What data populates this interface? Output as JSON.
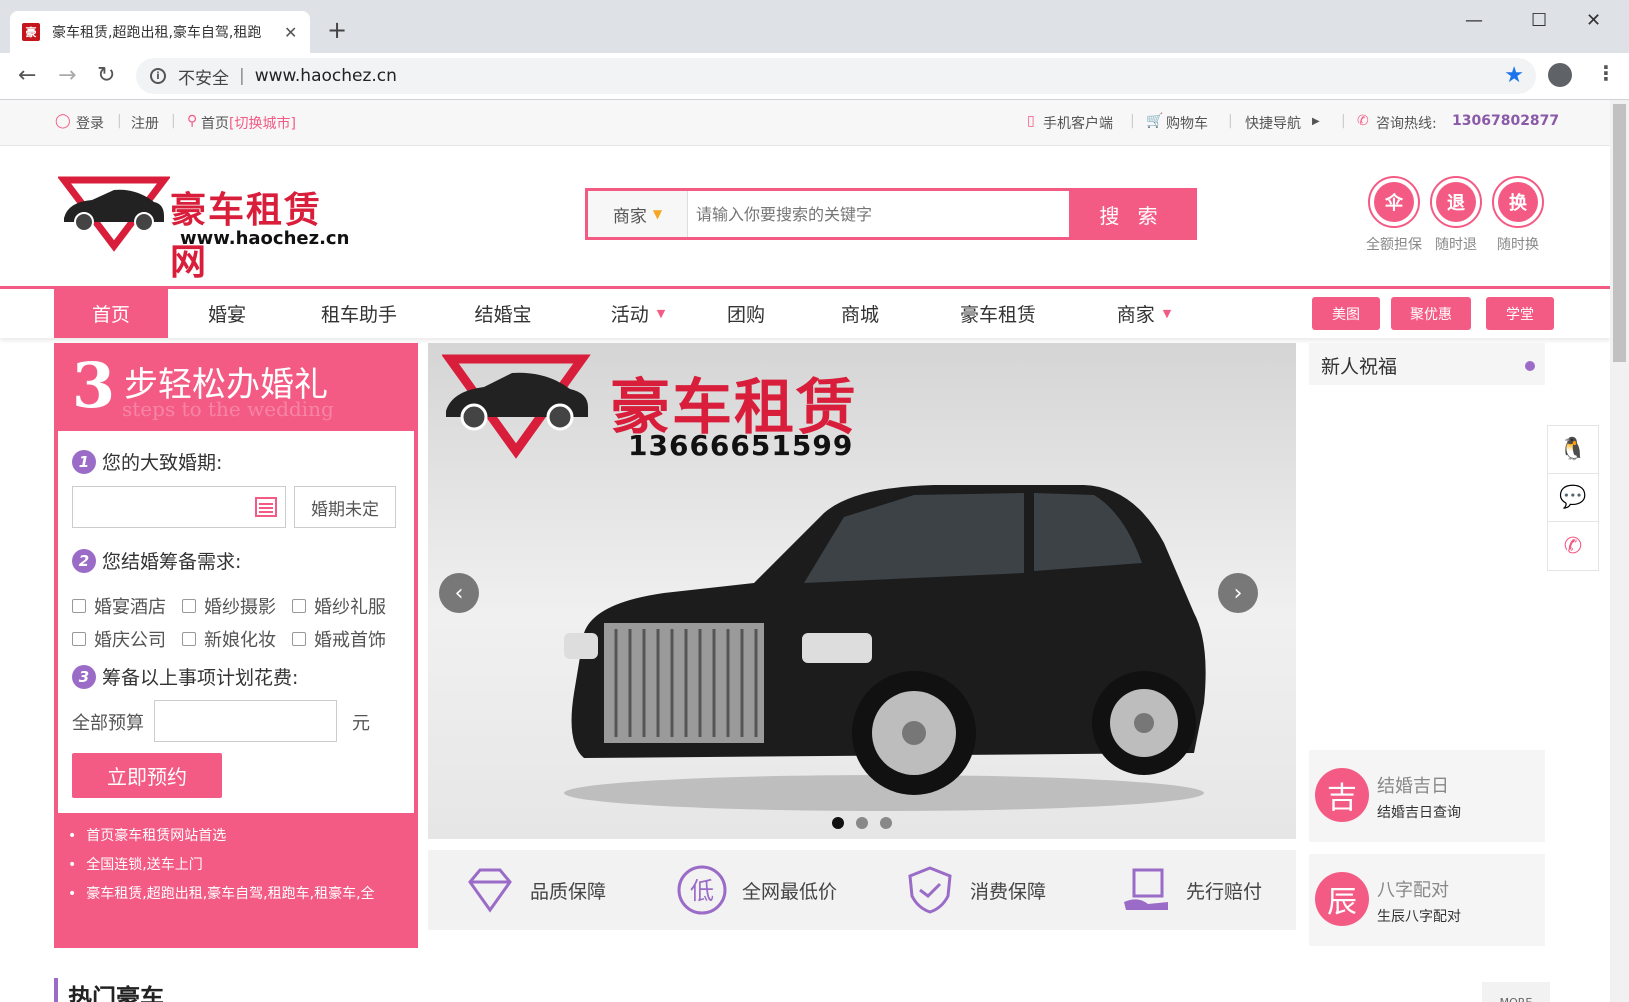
{
  "browser": {
    "tab_title": "豪车租赁,超跑出租,豪车自驾,租跑",
    "insecure_label": "不安全",
    "url": "www.haochez.cn"
  },
  "topbar": {
    "login": "登录",
    "register": "注册",
    "home": "首页",
    "switch_city": "[切换城市]",
    "mobile_client": "手机客户端",
    "cart": "购物车",
    "quick_nav": "快捷导航",
    "hotline_label": "咨询热线:",
    "hotline": "13067802877"
  },
  "header": {
    "logo_text": "豪车租赁网",
    "logo_url": "www.haochez.cn",
    "search_category": "商家",
    "search_placeholder": "请输入你要搜索的关键字",
    "search_button": "搜 索",
    "guarantees": [
      {
        "icon": "伞",
        "label": "全额担保"
      },
      {
        "icon": "退",
        "label": "随时退"
      },
      {
        "icon": "换",
        "label": "随时换"
      }
    ]
  },
  "nav": {
    "items": [
      "首页",
      "婚宴",
      "租车助手",
      "结婚宝",
      "活动",
      "团购",
      "商城",
      "豪车租赁",
      "商家"
    ],
    "pills": [
      "美图",
      "聚优惠",
      "学堂"
    ]
  },
  "wedding": {
    "number": "3",
    "title": "步轻松办婚礼",
    "subtitle": "steps to the wedding",
    "step1": "您的大致婚期:",
    "undecided": "婚期未定",
    "step2": "您结婚筹备需求:",
    "options": [
      "婚宴酒店",
      "婚纱摄影",
      "婚纱礼服",
      "婚庆公司",
      "新娘化妆",
      "婚戒首饰"
    ],
    "step3": "筹备以上事项计划花费:",
    "budget_label": "全部预算",
    "unit": "元",
    "book_button": "立即预约",
    "links": [
      "首页豪车租赁网站首选",
      "全国连锁,送车上门",
      "豪车租赁,超跑出租,豪车自驾,租跑车,租豪车,全"
    ]
  },
  "banner": {
    "brand": "豪车租赁",
    "phone": "13666651599",
    "slides": 3,
    "active_slide": 1
  },
  "features": [
    "品质保障",
    "全网最低价",
    "消费保障",
    "先行赔付"
  ],
  "sidebar": {
    "news_title": "新人祝福",
    "tools": [
      {
        "icon": "吉",
        "title": "结婚吉日",
        "desc": "结婚吉日查询"
      },
      {
        "icon": "辰",
        "title": "八字配对",
        "desc": "生辰八字配对"
      }
    ]
  },
  "section": {
    "hot_title": "热门豪车",
    "more": "MORE"
  },
  "colors": {
    "accent": "#f45b84",
    "purple": "#9b6cc7",
    "brand_red": "#d81e3a"
  }
}
